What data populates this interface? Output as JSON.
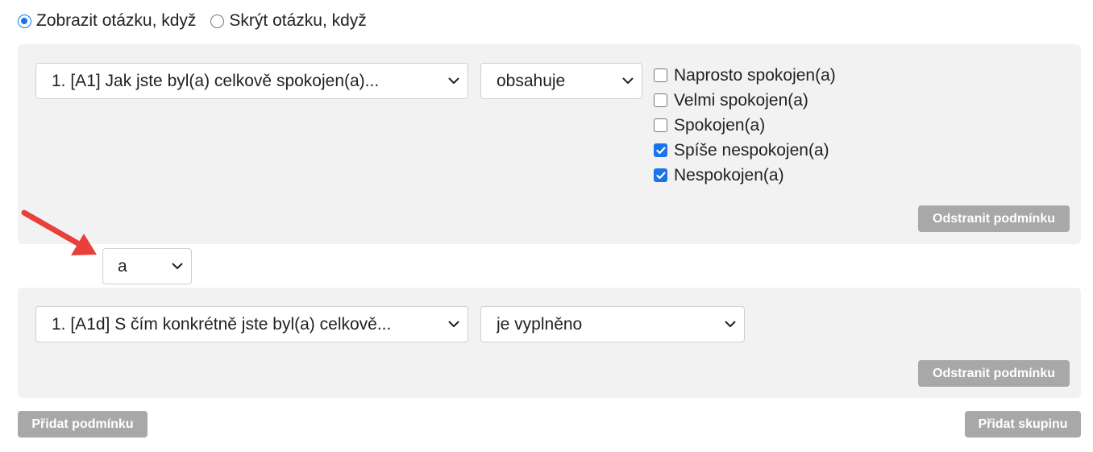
{
  "visibility_mode": {
    "options": [
      {
        "label": "Zobrazit otázku, když",
        "selected": true
      },
      {
        "label": "Skrýt otázku, když",
        "selected": false
      }
    ]
  },
  "conditions": [
    {
      "question": "1. [A1] Jak jste byl(a) celkově spokojen(a)...",
      "operator": "obsahuje",
      "options": [
        {
          "label": "Naprosto spokojen(a)",
          "checked": false
        },
        {
          "label": "Velmi spokojen(a)",
          "checked": false
        },
        {
          "label": "Spokojen(a)",
          "checked": false
        },
        {
          "label": "Spíše nespokojen(a)",
          "checked": true
        },
        {
          "label": "Nespokojen(a)",
          "checked": true
        }
      ],
      "remove_label": "Odstranit podmínku"
    },
    {
      "question": "1. [A1d] S čím konkrétně jste byl(a) celkově...",
      "operator": "je vyplněno",
      "remove_label": "Odstranit podmínku"
    }
  ],
  "logic_operator": "a",
  "footer": {
    "add_condition_label": "Přidat podmínku",
    "add_group_label": "Přidat skupinu"
  },
  "colors": {
    "accent": "#1a73e8",
    "panel": "#f2f2f2",
    "button": "#a8a8a8",
    "annotation_arrow": "#e8403a"
  },
  "icons": [
    "chevron-down-icon",
    "checkmark-icon",
    "annotation-arrow"
  ]
}
